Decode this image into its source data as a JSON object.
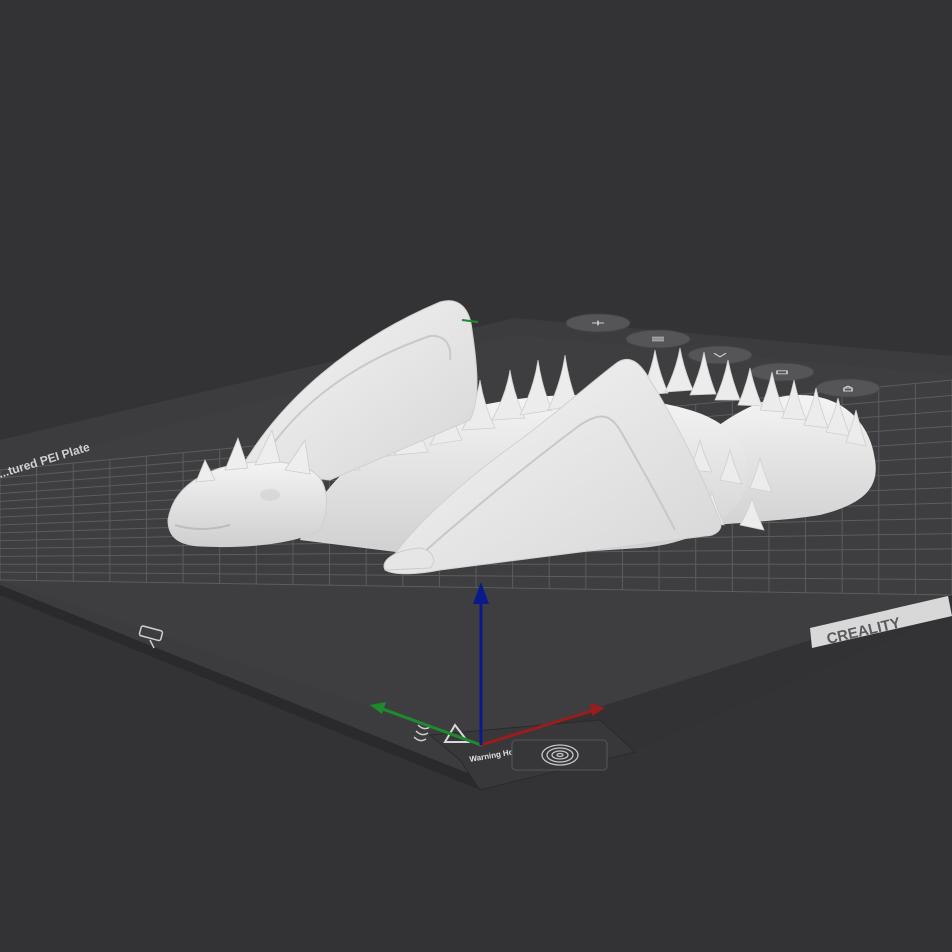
{
  "viewport": {
    "background_color": "#333335"
  },
  "plate": {
    "surface_label": "...tured PEI Plate",
    "brand": "CREALITY",
    "corner_label": "Warning Hot Surface",
    "bed_color": "#3c3c3e",
    "grid_color": "#5a5a5e",
    "edge_color": "#2a2a2c",
    "logo_icon": "printer-head-icon",
    "fingerprint_icon": "fingerprint-icon",
    "hot_surface_icon": "hot-surface-warning-icon"
  },
  "model": {
    "name": "dragon model",
    "color": "#e8e8e8",
    "shade_color": "#c8c8c8"
  },
  "axes": {
    "x_color": "#9b1c1c",
    "y_color": "#1e8a2e",
    "z_color": "#0a1a8c"
  },
  "toolbar": {
    "buttons": [
      {
        "id": "add",
        "icon": "plus-icon"
      },
      {
        "id": "arrange",
        "icon": "arrange-icon"
      },
      {
        "id": "orient",
        "icon": "orient-icon"
      },
      {
        "id": "settings",
        "icon": "plate-settings-icon"
      },
      {
        "id": "lock",
        "icon": "lock-icon"
      }
    ]
  }
}
